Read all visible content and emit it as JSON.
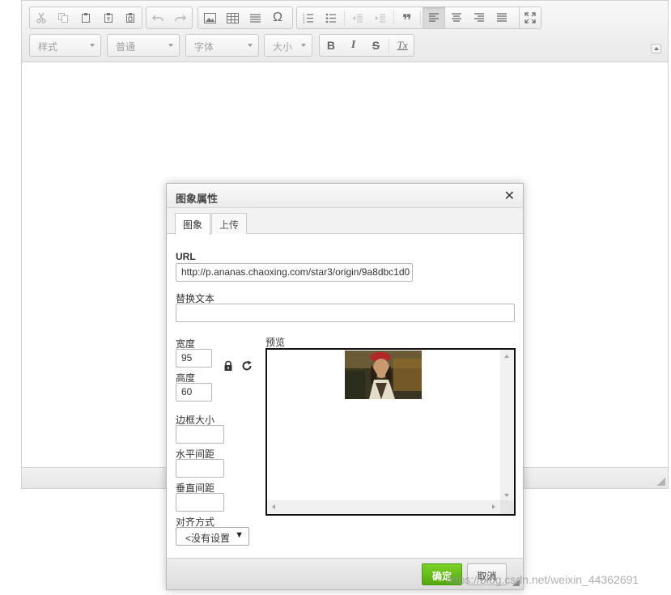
{
  "toolbar": {
    "styles_combo": "样式",
    "format_combo": "普通",
    "font_combo": "字体",
    "size_combo": "大小",
    "bold": "B",
    "italic": "I",
    "strike": "S",
    "remove_format": "Tx",
    "special_char": "Ω",
    "blockquote": "❞"
  },
  "dialog": {
    "title": "图象属性",
    "close": "✕",
    "tabs": [
      "图象",
      "上传"
    ],
    "url_label": "URL",
    "url_value": "http://p.ananas.chaoxing.com/star3/origin/9a8dbc1d0",
    "alt_label": "替换文本",
    "alt_value": "",
    "width_label": "宽度",
    "width_value": "95",
    "height_label": "高度",
    "height_value": "60",
    "border_label": "边框大小",
    "border_value": "",
    "hspace_label": "水平间距",
    "hspace_value": "",
    "vspace_label": "垂直间距",
    "vspace_value": "",
    "align_label": "对齐方式",
    "align_value": "<没有设置",
    "preview_label": "预览",
    "ok": "确定",
    "cancel": "取消"
  },
  "watermark": "https://blog.csdn.net/weixin_44362691",
  "colors": {
    "ok_button": "#66bb1e",
    "toolbar_bg": "#f0f0f0",
    "dialog_border": "#b9b9b9"
  }
}
